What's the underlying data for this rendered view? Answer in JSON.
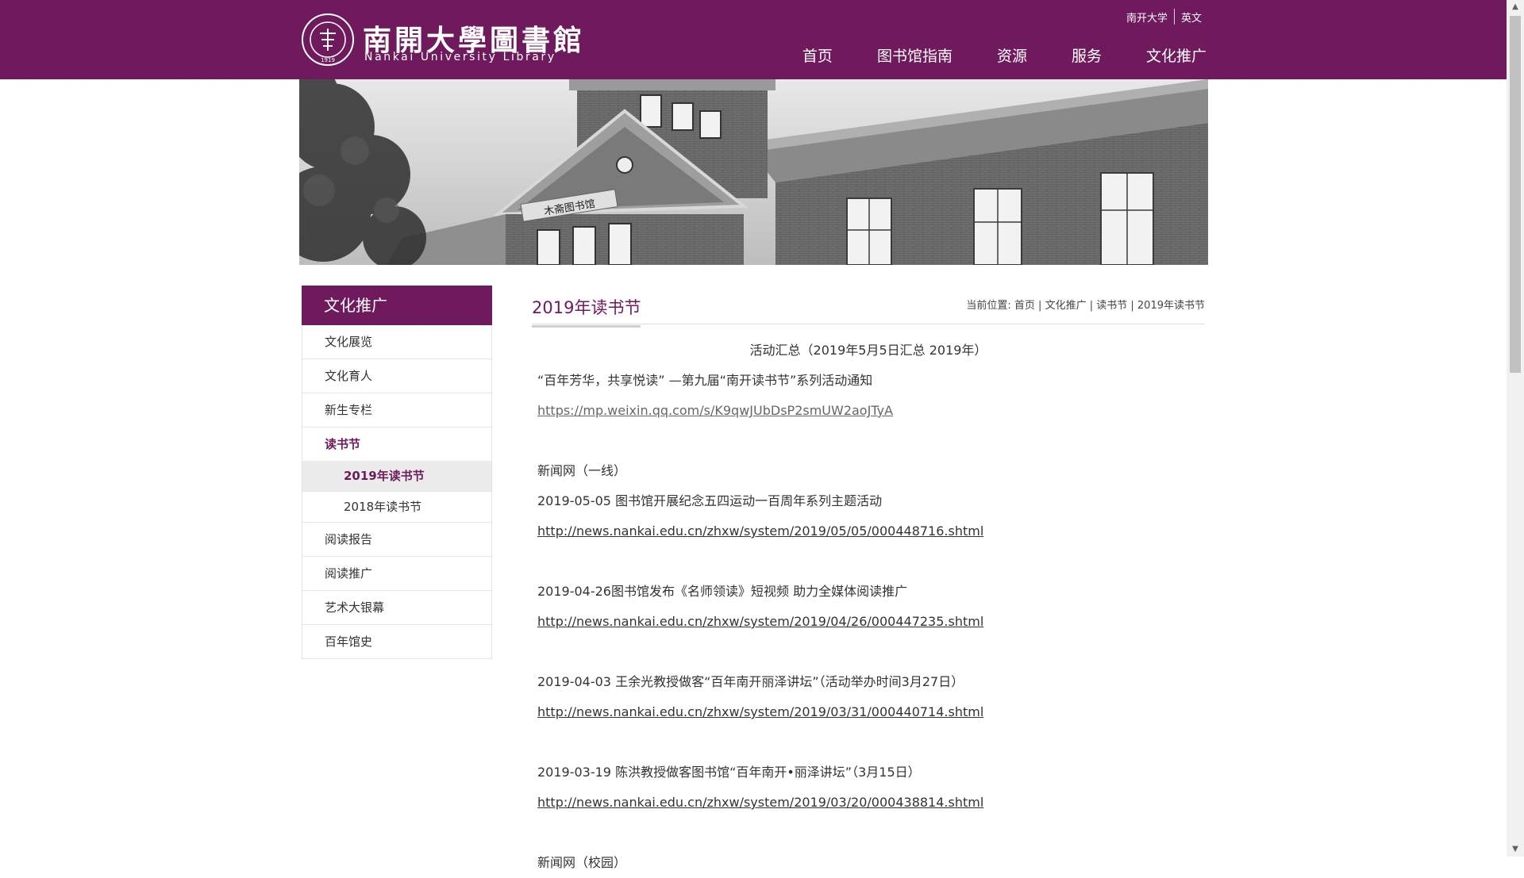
{
  "header": {
    "logo_cn": "南開大學圖書館",
    "logo_en": "Nankai University Library",
    "seal_text": "NANKAI UNIVERSITY",
    "seal_year": "1919",
    "top_links": [
      "南开大学",
      "英文"
    ],
    "nav": [
      "首页",
      "图书馆指南",
      "资源",
      "服务",
      "文化推广"
    ]
  },
  "banner": {
    "sign_text": "木斋图书馆"
  },
  "sidebar": {
    "title": "文化推广",
    "items": [
      {
        "label": "文化展览"
      },
      {
        "label": "文化育人"
      },
      {
        "label": "新生专栏"
      },
      {
        "label": "读书节",
        "active": true
      },
      {
        "label": "2019年读书节",
        "sub": true,
        "current": true
      },
      {
        "label": "2018年读书节",
        "sub": true
      },
      {
        "label": "阅读报告"
      },
      {
        "label": "阅读推广"
      },
      {
        "label": "艺术大银幕"
      },
      {
        "label": "百年馆史"
      }
    ]
  },
  "main": {
    "title": "2019年读书节",
    "breadcrumb": {
      "prefix": "当前位置:",
      "items": [
        "首页",
        "文化推广",
        "读书节",
        "2019年读书节"
      ]
    },
    "summary": "活动汇总（2019年5月5日汇总  2019年）",
    "notice": "“百年芳华，共享悦读” —第九届“南开读书节”系列活动通知",
    "notice_link": "https://mp.weixin.qq.com/s/K9qwJUbDsP2smUW2aoJTyA",
    "news_heading": "新闻网（一线）",
    "news": [
      {
        "text": "2019-05-05 图书馆开展纪念五四运动一百周年系列主题活动",
        "link": "http://news.nankai.edu.cn/zhxw/system/2019/05/05/000448716.shtml"
      },
      {
        "text": "2019-04-26图书馆发布《名师领读》短视频 助力全媒体阅读推广",
        "link": "http://news.nankai.edu.cn/zhxw/system/2019/04/26/000447235.shtml"
      },
      {
        "text": "2019-04-03 王余光教授做客“百年南开丽泽讲坛”（活动举办时间3月27日）",
        "link": "http://news.nankai.edu.cn/zhxw/system/2019/03/31/000440714.shtml"
      },
      {
        "text": "2019-03-19 陈洪教授做客图书馆“百年南开•丽泽讲坛”（3月15日）",
        "link": "http://news.nankai.edu.cn/zhxw/system/2019/03/20/000438814.shtml"
      }
    ],
    "next_heading": "新闻网（校园）"
  },
  "colors": {
    "brand": "#6f1a5c",
    "active_bg": "#ececec"
  }
}
